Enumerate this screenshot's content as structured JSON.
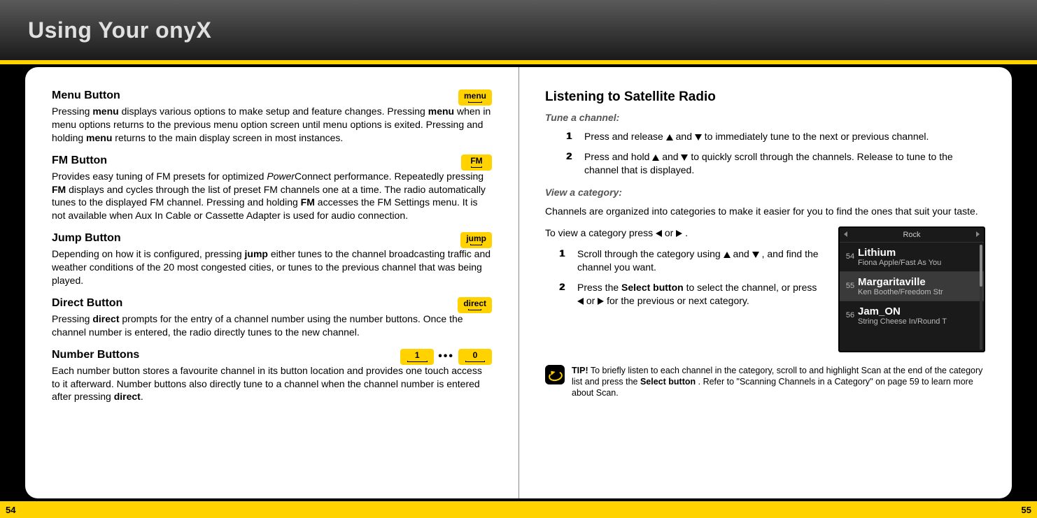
{
  "header": {
    "title": "Using Your onyX"
  },
  "left": {
    "menu": {
      "title": "Menu Button",
      "label": "menu",
      "body": "Pressing <b>menu</b> displays various options to make setup and feature changes. Pressing <b>menu</b> when in menu options returns to the previous menu option screen until menu options is exited. Pressing and holding <b>menu</b> returns to the main display screen in most instances."
    },
    "fm": {
      "title": "FM Button",
      "label": "FM",
      "body": "Provides easy tuning of FM presets for optimized <i>Power</i>Connect performance. Repeatedly pressing <b>FM</b> displays and cycles through the list of preset FM channels one at a time. The radio automatically tunes to the displayed FM channel. Pressing and holding <b>FM</b> accesses the FM Settings menu. It is not available when Aux In Cable or Cassette Adapter is used for audio connection."
    },
    "jump": {
      "title": "Jump Button",
      "label": "jump",
      "body": "Depending on how it is configured, pressing <b>jump</b> either tunes to the channel broadcasting traffic and weather conditions of the 20 most congested cities, or tunes to the previous channel that was being played."
    },
    "direct": {
      "title": "Direct Button",
      "label": "direct",
      "body": "Pressing <b>direct</b> prompts for the entry of a channel number using the number buttons. Once the channel number is entered, the radio directly tunes to the new channel."
    },
    "number": {
      "title": "Number Buttons",
      "btn1": "1",
      "dots": "•••",
      "btn0": "0",
      "body": "Each number button stores a favourite channel in its button location and provides one touch access to it afterward. Number buttons also directly tune to a channel when the channel number is entered after pressing <b>direct</b>."
    }
  },
  "right": {
    "title": "Listening to Satellite Radio",
    "tune_subhead": "Tune a channel:",
    "tune_steps": [
      {
        "n": "1",
        "pre": "Press and release ",
        "post": " to immediately tune to the next or previous channel."
      },
      {
        "n": "2",
        "pre": "Press and hold ",
        "post": " to quickly scroll through the channels. Release to tune to the channel that is displayed."
      }
    ],
    "view_subhead": "View a category:",
    "view_intro": "Channels are organized into categories to make it easier for you to find the ones that suit your taste.",
    "view_lead_pre": "To view a category press ",
    "view_lead_mid": " or ",
    "view_lead_post": ".",
    "view_steps": [
      {
        "n": "1",
        "pre": "Scroll through the category using ",
        "mid": ", ",
        "post": " and find the channel you want."
      },
      {
        "n": "2",
        "pre": "Press the ",
        "bold1": "Select button",
        "mid": " to select the channel, or press ",
        "lr_mid": " or ",
        "post": " for the previous or next category."
      }
    ],
    "device": {
      "category": "Rock",
      "rows": [
        {
          "num": "54",
          "name": "Lithium",
          "artist": "Fiona Apple/Fast As You",
          "selected": false
        },
        {
          "num": "55",
          "name": "Margaritaville",
          "artist": "Ken Boothe/Freedom Str",
          "selected": true
        },
        {
          "num": "56",
          "name": "Jam_ON",
          "artist": "String Cheese In/Round T",
          "selected": false
        }
      ]
    },
    "tip": {
      "label": "TIP!",
      "text": " To briefly listen to each channel in the category, scroll to and highlight Scan at the end of the category list and press the ",
      "bold": "Select button",
      "text2": ". Refer to \"Scanning Channels in a Category\" on page 59 to learn more about Scan."
    }
  },
  "footer": {
    "left": "54",
    "right": "55"
  }
}
